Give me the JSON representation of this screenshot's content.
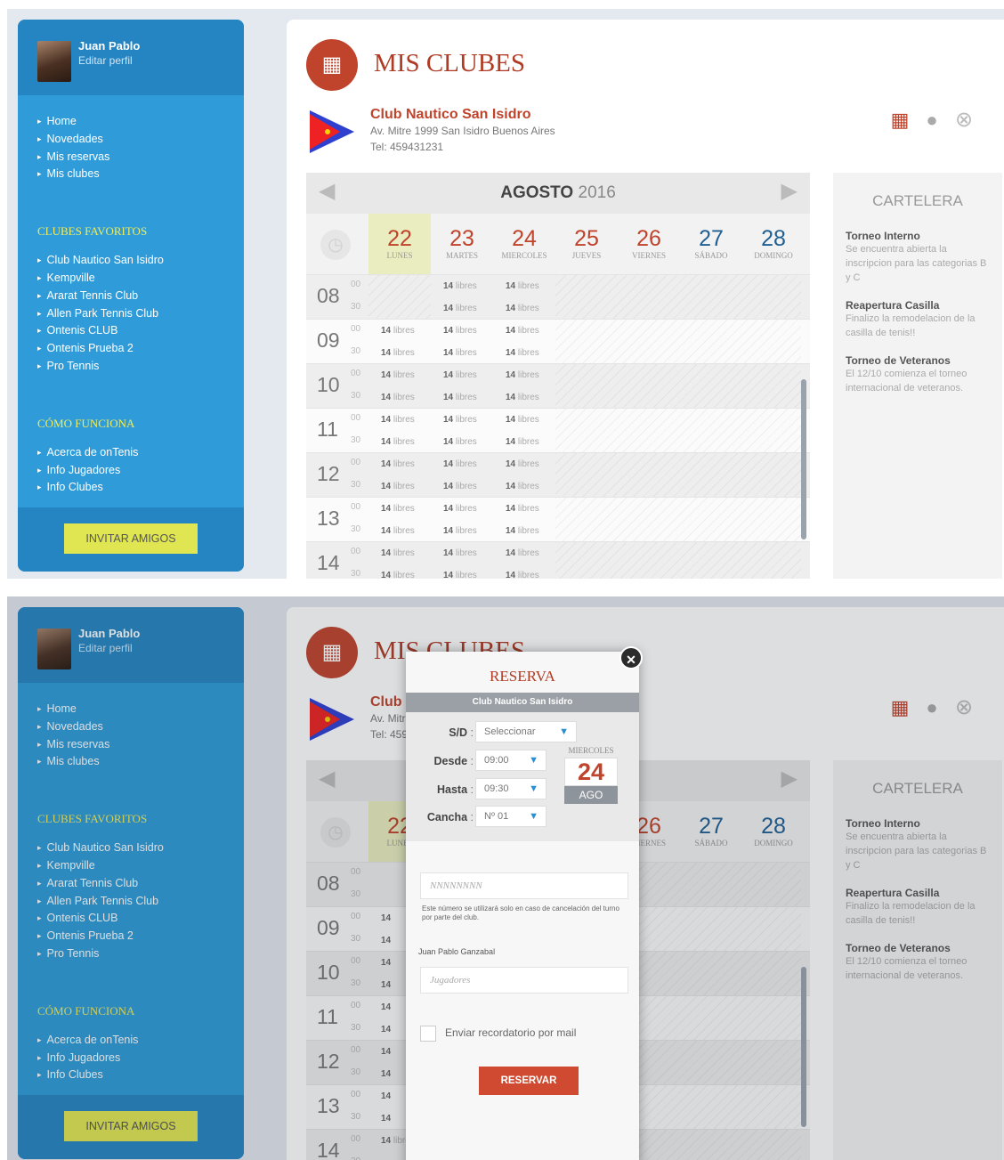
{
  "user": {
    "name": "Juan Pablo",
    "edit_label": "Editar perfil"
  },
  "menu": [
    "Home",
    "Novedades",
    "Mis reservas",
    "Mis clubes"
  ],
  "favorites": {
    "title": "CLUBES FAVORITOS",
    "items": [
      "Club Nautico San Isidro",
      "Kempville",
      "Ararat Tennis Club",
      "Allen Park Tennis Club",
      "Ontenis CLUB",
      "Ontenis Prueba 2",
      "Pro Tennis"
    ]
  },
  "howto": {
    "title": "CÓMO FUNCIONA",
    "items": [
      "Acerca de onTenis",
      "Info Jugadores",
      "Info Clubes"
    ]
  },
  "invite_label": "INVITAR AMIGOS",
  "page_title": "MIS CLUBES",
  "club": {
    "name": "Club Nautico San Isidro",
    "address": "Av. Mitre 1999 San Isidro Buenos Aires",
    "tel": "Tel: 459431231"
  },
  "icons": {
    "calendar": "calendar-icon",
    "location": "map-pin-icon",
    "close": "close-circle-icon",
    "prev": "arrow-left-icon",
    "next": "arrow-right-icon",
    "clock": "clock-icon"
  },
  "calendar": {
    "month": "AGOSTO",
    "year": "2016",
    "days": [
      {
        "num": "22",
        "name": "LUNES"
      },
      {
        "num": "23",
        "name": "MARTES"
      },
      {
        "num": "24",
        "name": "MIERCOLES"
      },
      {
        "num": "25",
        "name": "JUEVES"
      },
      {
        "num": "26",
        "name": "VIERNES"
      },
      {
        "num": "27",
        "name": "SÁBADO"
      },
      {
        "num": "28",
        "name": "DOMINGO"
      }
    ],
    "hours": [
      "08",
      "09",
      "10",
      "11",
      "12",
      "13",
      "14"
    ],
    "minutes": [
      "00",
      "30"
    ],
    "slot_count": "14",
    "slot_word": "libres"
  },
  "cartelera": {
    "title": "CARTELERA",
    "items": [
      {
        "title": "Torneo Interno",
        "body": "Se encuentra abierta la inscripcion para las categorias B y C"
      },
      {
        "title": "Reapertura Casilla",
        "body": "Finalizo la remodelacion de la casilla de tenis!!"
      },
      {
        "title": "Torneo de Veteranos",
        "body": "El 12/10 comienza el torneo internacional de veteranos."
      }
    ]
  },
  "modal": {
    "title": "RESERVA",
    "club": "Club Nautico San Isidro",
    "sd_label": "S/D",
    "sd_value": "Seleccionar",
    "desde_label": "Desde",
    "desde_value": "09:00",
    "hasta_label": "Hasta",
    "hasta_value": "09:30",
    "cancha_label": "Cancha",
    "cancha_value": "Nº 01",
    "day_name": "MIERCOLES",
    "day_num": "24",
    "month": "AGO",
    "phone_placeholder": "NNNNNNNN",
    "phone_help": "Este número se utilizará solo en caso de cancelación del turno por parte del club.",
    "player_name": "Juan Pablo Ganzabal",
    "players_placeholder": "Jugadores",
    "reminder_label": "Enviar recordatorio por mail",
    "submit": "RESERVAR"
  }
}
